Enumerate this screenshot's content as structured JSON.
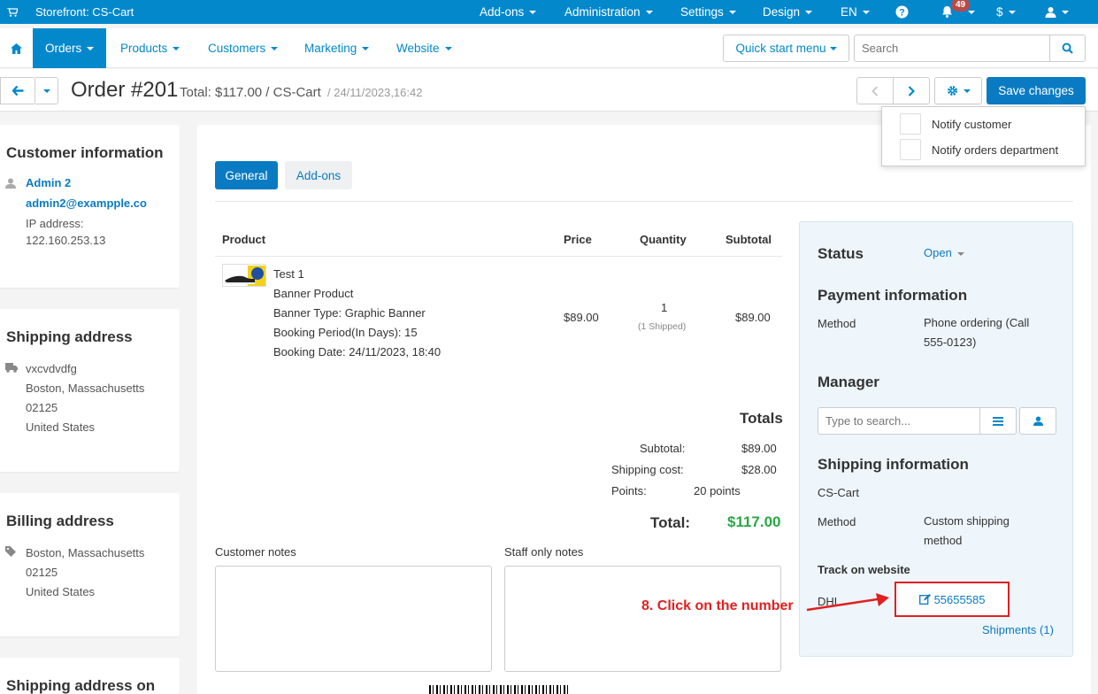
{
  "topbar": {
    "store": "Storefront: CS-Cart",
    "addons": "Add-ons",
    "administration": "Administration",
    "settings": "Settings",
    "design": "Design",
    "language": "EN",
    "notifications_count": "49",
    "currency": "$"
  },
  "nav": {
    "orders": "Orders",
    "products": "Products",
    "customers": "Customers",
    "marketing": "Marketing",
    "website": "Website",
    "quick_start": "Quick start menu",
    "search_placeholder": "Search"
  },
  "title": {
    "order": "Order #201",
    "total": "Total: $117.00 / CS-Cart",
    "date": "/ 24/11/2023,16:42",
    "save": "Save changes"
  },
  "notify": {
    "customer": "Notify customer",
    "orders_dept": "Notify orders department"
  },
  "customer_info": {
    "title": "Customer information",
    "name": "Admin 2",
    "email": "admin2@exampple.co",
    "ip_label": "IP address:",
    "ip": "122.160.253.13"
  },
  "shipping_address": {
    "title": "Shipping address",
    "line1": "vxcvdvdfg",
    "line2": "Boston, Massachusetts",
    "line3": "02125",
    "line4": "United States"
  },
  "billing_address": {
    "title": "Billing address",
    "line1": "Boston, Massachusetts",
    "line2": "02125",
    "line3": "United States"
  },
  "shipping_address_on": {
    "title": "Shipping address on"
  },
  "tabs": {
    "general": "General",
    "addons": "Add-ons"
  },
  "table": {
    "headers": {
      "product": "Product",
      "price": "Price",
      "quantity": "Quantity",
      "subtotal": "Subtotal"
    },
    "row": {
      "name": "Test 1",
      "type": "Banner Product",
      "banner_type": "Banner Type: Graphic Banner",
      "booking_period": "Booking Period(In Days): 15",
      "booking_date": "Booking Date: 24/11/2023, 18:40",
      "price": "$89.00",
      "quantity": "1",
      "shipped": "(1 Shipped)",
      "subtotal": "$89.00"
    }
  },
  "totals": {
    "title": "Totals",
    "subtotal_label": "Subtotal:",
    "subtotal": "$89.00",
    "shipping_label": "Shipping cost:",
    "shipping": "$28.00",
    "points_label": "Points:",
    "points": "20 points",
    "total_label": "Total:",
    "total": "$117.00"
  },
  "notes": {
    "customer": "Customer notes",
    "staff": "Staff only notes"
  },
  "sidebar": {
    "status_title": "Status",
    "status_value": "Open",
    "payment_title": "Payment information",
    "method_label": "Method",
    "payment_method_l1": "Phone ordering (Call",
    "payment_method_l2": "555-0123)",
    "manager_title": "Manager",
    "manager_placeholder": "Type to search...",
    "shipping_title": "Shipping information",
    "carrier_store": "CS-Cart",
    "ship_method_label": "Method",
    "ship_method_l1": "Custom shipping",
    "ship_method_l2": "method",
    "track_title": "Track on website",
    "carrier": "DHL",
    "tracking_number": "55655585",
    "shipments": "Shipments (1)"
  },
  "annotation": "8. Click on the number",
  "colors": {
    "primary": "#0388cc",
    "annotation": "#e02020",
    "total_green": "#29a745"
  }
}
